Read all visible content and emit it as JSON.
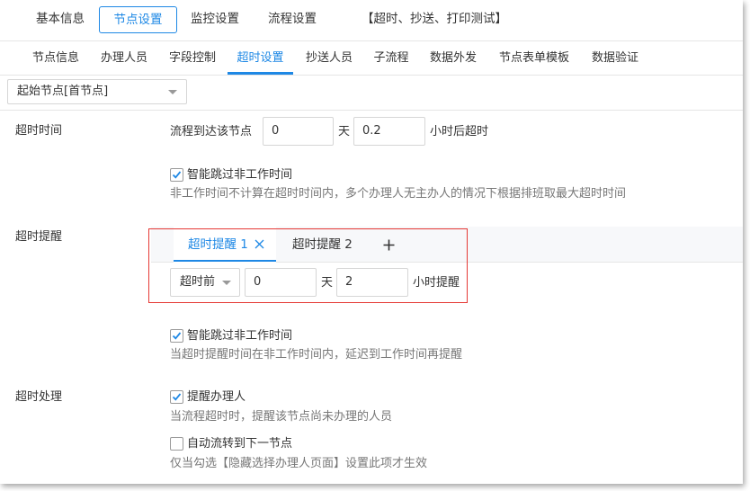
{
  "top_tabs": [
    {
      "label": "基本信息"
    },
    {
      "label": "节点设置",
      "active": true
    },
    {
      "label": "监控设置"
    },
    {
      "label": "流程设置"
    }
  ],
  "workflow_title": "【超时、抄送、打印测试】",
  "sub_tabs": [
    {
      "label": "节点信息"
    },
    {
      "label": "办理人员"
    },
    {
      "label": "字段控制"
    },
    {
      "label": "超时设置",
      "active": true
    },
    {
      "label": "抄送人员"
    },
    {
      "label": "子流程"
    },
    {
      "label": "数据外发"
    },
    {
      "label": "节点表单模板"
    },
    {
      "label": "数据验证"
    }
  ],
  "node_select": {
    "value": "起始节点[首节点]"
  },
  "timeout_time": {
    "label": "超时时间",
    "prefix": "流程到达该节点",
    "days_value": "0",
    "days_unit": "天",
    "hours_value": "0.2",
    "hours_suffix": "小时后超时",
    "skip_nonwork": {
      "label": "智能跳过非工作时间",
      "checked": true
    },
    "hint": "非工作时间不计算在超时时间内，多个办理人无主办人的情况下根据排班取最大超时时间"
  },
  "timeout_reminder": {
    "label": "超时提醒",
    "tabs": [
      {
        "label": "超时提醒 1",
        "active": true,
        "closable": true
      },
      {
        "label": "超时提醒 2"
      }
    ],
    "add_icon": "plus-icon",
    "when_select": "超时前",
    "days_value": "0",
    "days_unit": "天",
    "hours_value": "2",
    "hours_suffix": "小时提醒",
    "skip_nonwork": {
      "label": "智能跳过非工作时间",
      "checked": true
    },
    "hint": "当超时提醒时间在非工作时间内，延迟到工作时间再提醒"
  },
  "timeout_handling": {
    "label": "超时处理",
    "remind_handler": {
      "label": "提醒办理人",
      "checked": true
    },
    "remind_hint": "当流程超时时，提醒该节点尚未办理的人员",
    "auto_forward": {
      "label": "自动流转到下一节点",
      "checked": false
    },
    "auto_hint": "仅当勾选【隐藏选择办理人页面】设置此项才生效"
  },
  "colors": {
    "accent": "#1e88e5",
    "highlight_box": "#e53935"
  }
}
